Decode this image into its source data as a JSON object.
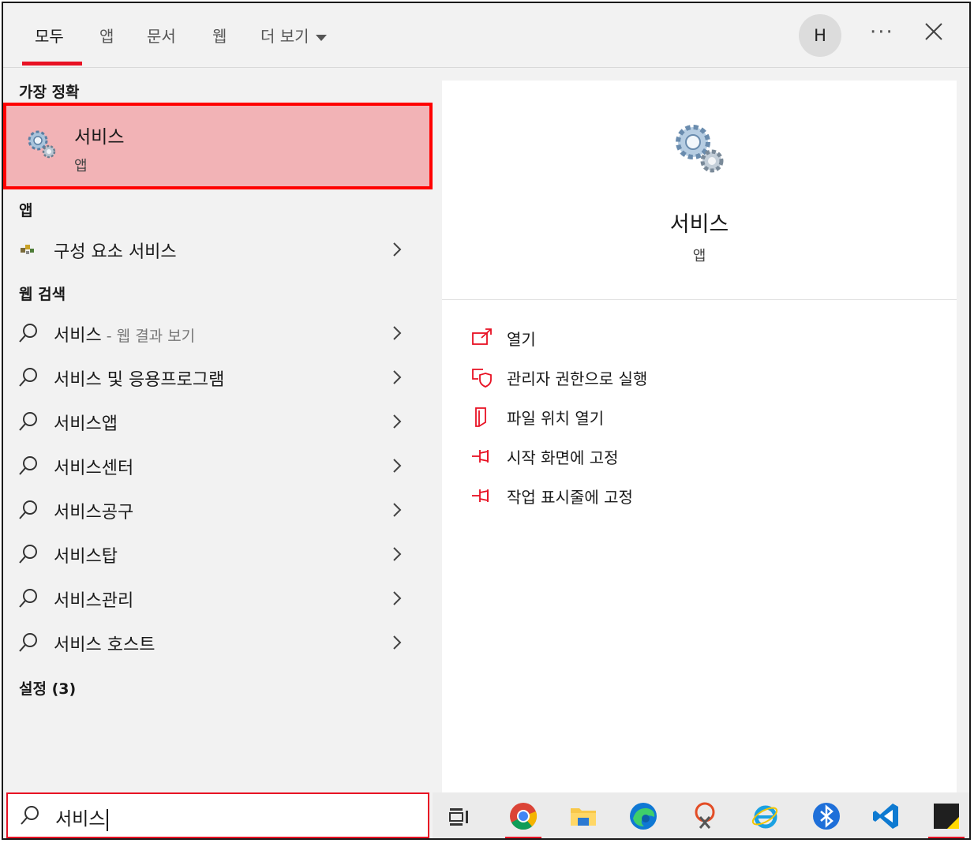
{
  "tabs": [
    {
      "label": "모두",
      "active": true
    },
    {
      "label": "앱",
      "active": false
    },
    {
      "label": "문서",
      "active": false
    },
    {
      "label": "웹",
      "active": false
    },
    {
      "label": "더 보기",
      "active": false
    }
  ],
  "account": {
    "initial": "H"
  },
  "more_label": "···",
  "sections": {
    "best_match": "가장 정확",
    "apps": "앱",
    "web": "웹 검색",
    "settings": "설정 (3)"
  },
  "best_match_item": {
    "title": "서비스",
    "subtitle": "앱"
  },
  "app_items": [
    {
      "label": "구성 요소 서비스"
    }
  ],
  "web_items": [
    {
      "label": "서비스",
      "hint": " - 웹 결과 보기"
    },
    {
      "label": "서비스 및 응용프로그램",
      "hint": ""
    },
    {
      "label": "서비스앱",
      "hint": ""
    },
    {
      "label": "서비스센터",
      "hint": ""
    },
    {
      "label": "서비스공구",
      "hint": ""
    },
    {
      "label": "서비스탑",
      "hint": ""
    },
    {
      "label": "서비스관리",
      "hint": ""
    },
    {
      "label": "서비스 호스트",
      "hint": ""
    }
  ],
  "search": {
    "value": "서비스"
  },
  "preview": {
    "title": "서비스",
    "subtitle": "앱"
  },
  "actions": [
    {
      "label": "열기",
      "icon": "open-icon"
    },
    {
      "label": "관리자 권한으로 실행",
      "icon": "shield-icon"
    },
    {
      "label": "파일 위치 열기",
      "icon": "file-location-icon"
    },
    {
      "label": "시작 화면에 고정",
      "icon": "pin-icon"
    },
    {
      "label": "작업 표시줄에 고정",
      "icon": "pin-icon"
    }
  ],
  "taskbar": [
    "task-view-icon",
    "chrome-icon",
    "file-explorer-icon",
    "edge-icon",
    "snipping-tool-icon",
    "internet-explorer-icon",
    "bluetooth-icon",
    "vscode-icon",
    "sticky-notes-icon"
  ],
  "colors": {
    "accent": "#e81123",
    "highlight": "#f2b3b6",
    "highlight_border": "#ff0000"
  }
}
